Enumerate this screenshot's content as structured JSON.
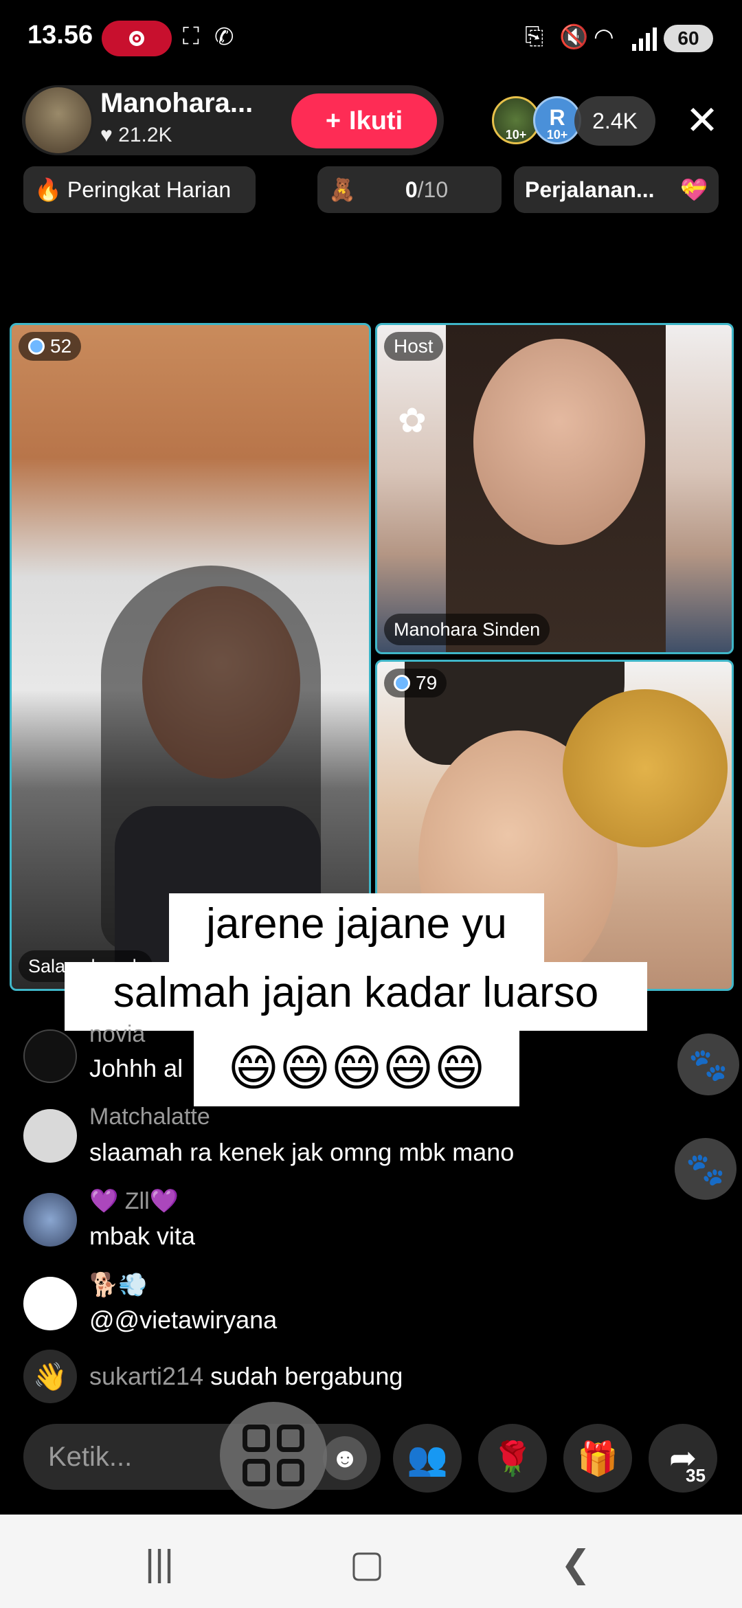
{
  "status_bar": {
    "time": "13.56",
    "battery": "60"
  },
  "header": {
    "host_name": "Manohara...",
    "likes": "21.2K",
    "follow_label": "Ikuti",
    "viewer_badges": [
      "10+",
      "10+"
    ],
    "viewer_initial": "R",
    "viewer_count": "2.4K"
  },
  "chips": {
    "ranking": "Peringkat Harian",
    "goal_current": "0",
    "goal_total": "/10",
    "journey": "Perjalanan..."
  },
  "tiles": {
    "left_score": "52",
    "left_name": "Salamah mah",
    "host_tag": "Host",
    "host_name": "Manohara Sinden",
    "bottom_score": "79"
  },
  "caption": {
    "line1": "jarene jajane yu",
    "line2": "salmah  jajan kadar luarso",
    "line3": "😄😄😄😄😄"
  },
  "comments": [
    {
      "user": "novia",
      "text": "Johhh al"
    },
    {
      "user": "Matchalatte",
      "text": "slaamah ra kenek jak omng mbk mano"
    },
    {
      "user": "💜 Zll💜",
      "text": "mbak vita"
    },
    {
      "user": "🐕💨",
      "text": "@@vietawiryana"
    }
  ],
  "join_notice": {
    "user": "sukarti214",
    "text": "sudah bergabung"
  },
  "bottom_bar": {
    "input_placeholder": "Ketik...",
    "share_count": "35"
  }
}
